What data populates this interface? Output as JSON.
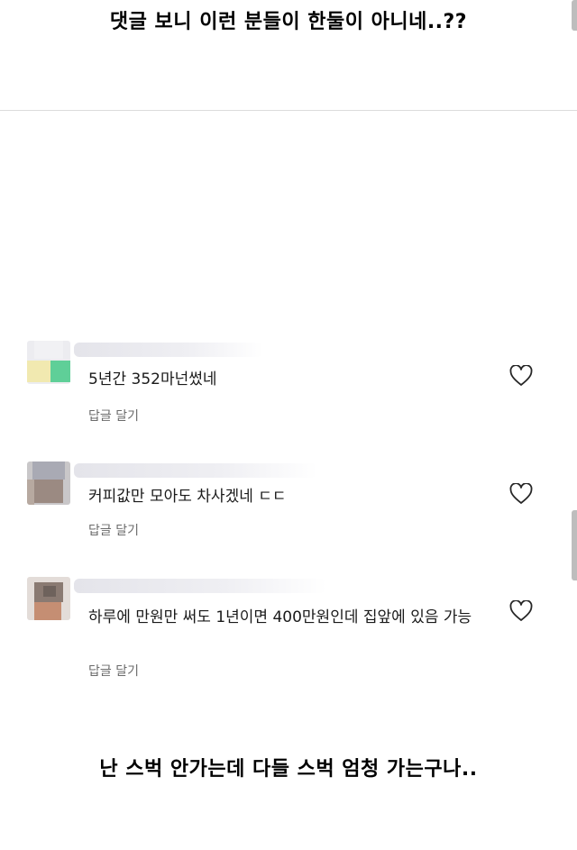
{
  "captions": {
    "top": "댓글 보니 이런 분들이 한둘이 아니네..??",
    "bottom": "난 스벅 안가는데 다들 스벅 엄청 가는구나.."
  },
  "comments": [
    {
      "text": "5년간 352마넌썼네",
      "reply_label": "답글 달기",
      "icon": "heart-outline-icon"
    },
    {
      "text": "커피값만 모아도 차사겠네 ㄷㄷ",
      "reply_label": "답글 달기",
      "icon": "heart-outline-icon"
    },
    {
      "text": "하루에 만원만 써도 1년이면 400만원인데 집앞에 있음 가능",
      "reply_label": "답글 달기",
      "icon": "heart-outline-icon"
    }
  ],
  "colors": {
    "heart_stroke": "#262626",
    "reply_text": "#6b6b6b",
    "divider": "#dcdcdc"
  }
}
